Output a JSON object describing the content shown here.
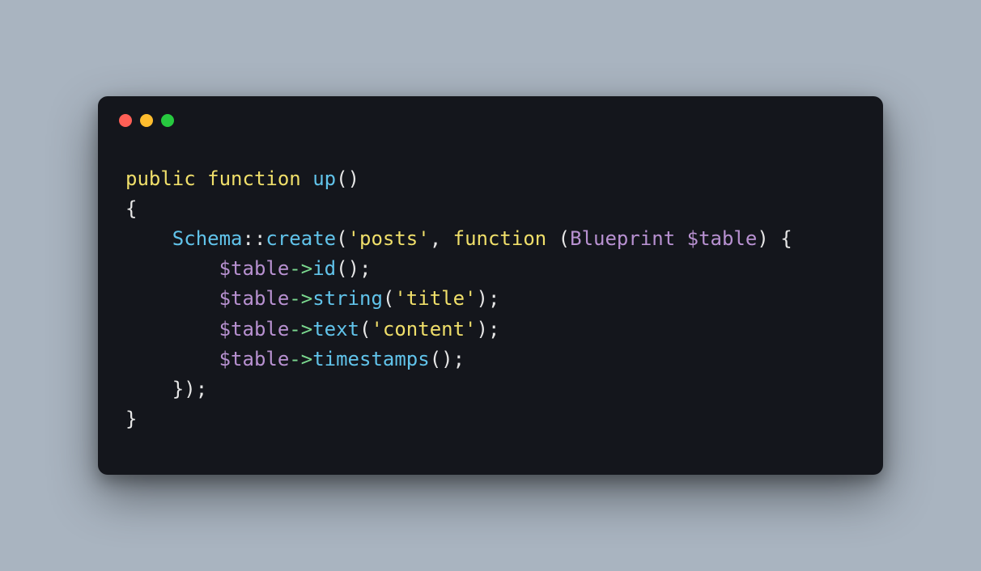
{
  "window": {
    "traffic_lights": {
      "red": "#ff5f56",
      "yellow": "#ffbd2e",
      "green": "#27c93f"
    }
  },
  "code": {
    "language": "php",
    "tokens": {
      "kw_public": "public",
      "kw_function": "function",
      "fn_up": "up",
      "paren_open": "(",
      "paren_close": ")",
      "brace_open": "{",
      "brace_close": "}",
      "class_schema": "Schema",
      "op_scope": "::",
      "method_create": "create",
      "str_posts": "'posts'",
      "comma": ",",
      "sp": " ",
      "type_blueprint": "Blueprint",
      "var_table": "$table",
      "arrow": "->",
      "method_id": "id",
      "method_string": "string",
      "method_text": "text",
      "method_timestamps": "timestamps",
      "str_title": "'title'",
      "str_content": "'content'",
      "semi": ";"
    },
    "indent1": "    ",
    "indent2": "        "
  }
}
